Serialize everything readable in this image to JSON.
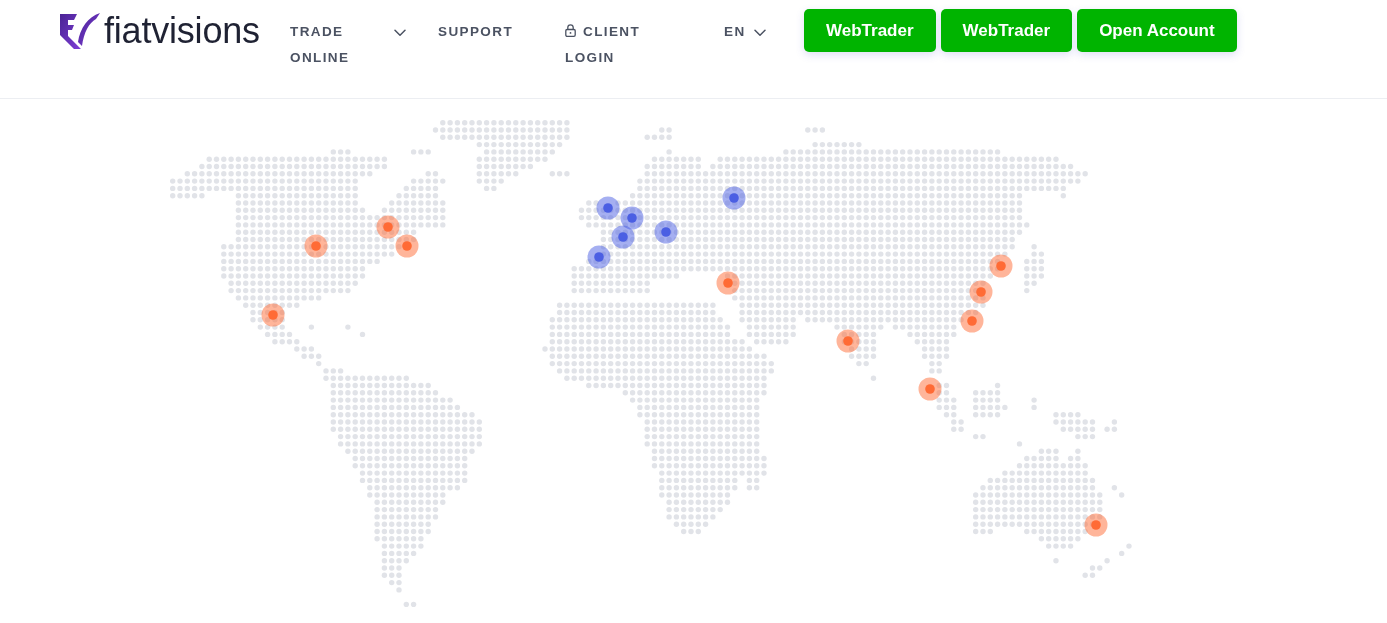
{
  "header": {
    "logo": {
      "text": "fiatvisions"
    },
    "nav": [
      {
        "label": "TRADE ONLINE",
        "kind": "dropdown"
      },
      {
        "label": "SUPPORT",
        "kind": "link"
      },
      {
        "label": "CLIENT LOGIN",
        "kind": "login"
      },
      {
        "label": "EN",
        "kind": "dropdown"
      }
    ],
    "buttons": [
      {
        "label": "WebTrader"
      },
      {
        "label": "WebTrader"
      },
      {
        "label": "Open Account"
      }
    ]
  },
  "map": {
    "markers": [
      {
        "color": "#4b5fe3"
      },
      {
        "color": "#4b5fe3"
      },
      {
        "color": "#4b5fe3"
      },
      {
        "color": "#ff6b35"
      },
      {
        "color": "#4b5fe3"
      },
      {
        "color": "#4b5fe3"
      },
      {
        "color": "#ff6b35"
      },
      {
        "color": "#ff6b35"
      },
      {
        "color": "#4b5fe3"
      },
      {
        "color": "#ff6b35"
      },
      {
        "color": "#ff6b35"
      },
      {
        "color": "#ff6b35"
      },
      {
        "color": "#ff6b35"
      },
      {
        "color": "#ff6b35"
      },
      {
        "color": "#ff6b35"
      },
      {
        "color": "#ff6b35"
      },
      {
        "color": "#ff6b35"
      }
    ]
  }
}
